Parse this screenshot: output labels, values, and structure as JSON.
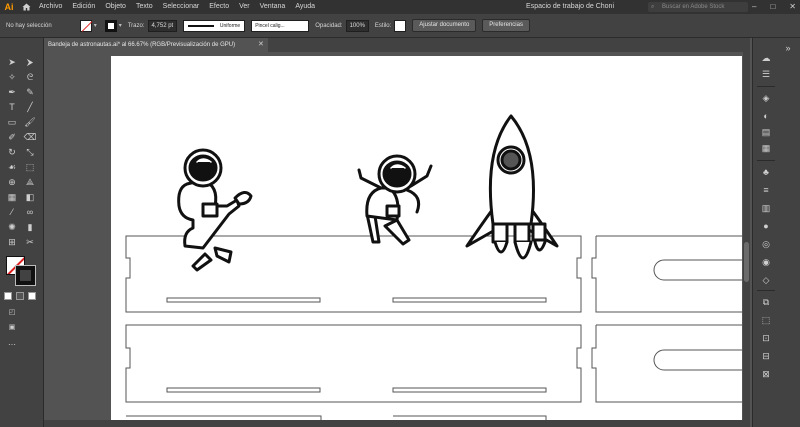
{
  "app": {
    "logo": "Ai",
    "home_icon": "home-icon"
  },
  "menu": [
    "Archivo",
    "Edición",
    "Objeto",
    "Texto",
    "Seleccionar",
    "Efecto",
    "Ver",
    "Ventana",
    "Ayuda"
  ],
  "workspace_label": "Espacio de trabajo de Choni",
  "search": {
    "placeholder": "Buscar en Adobe Stock"
  },
  "window_controls": {
    "minimize": "–",
    "maximize": "□",
    "close": "✕"
  },
  "control_bar": {
    "selection_status": "No hay selección",
    "stroke_label": "Trazo:",
    "stroke_weight": "4,752 pt",
    "stroke_profile": "Uniforme",
    "brush": "Pincel calig...",
    "opacity_label": "Opacidad:",
    "opacity_value": "100%",
    "style_label": "Estilo:",
    "doc_setup_button": "Ajustar documento",
    "preferences_button": "Preferencias"
  },
  "document_tab": {
    "title": "Bandeja de astronautas.ai* al 66.67% (RGB/Previsualización de GPU)",
    "close": "✕"
  },
  "colors": {
    "menubar": "#323232",
    "panel": "#424242",
    "canvas": "#535353",
    "artboard": "#ffffff",
    "accent": "#ff9a00",
    "none_slash": "#e02020"
  },
  "tools": [
    "selection-icon",
    "direct-selection-icon",
    "magic-wand-icon",
    "lasso-icon",
    "pen-icon",
    "curvature-icon",
    "type-icon",
    "line-icon",
    "rectangle-icon",
    "paintbrush-icon",
    "shaper-icon",
    "eraser-icon",
    "rotate-icon",
    "scale-icon",
    "warp-icon",
    "free-transform-icon",
    "shape-builder-icon",
    "perspective-icon",
    "mesh-icon",
    "gradient-icon",
    "eyedropper-icon",
    "blend-icon",
    "symbol-sprayer-icon",
    "column-graph-icon",
    "artboard-icon",
    "slice-icon",
    "hand-icon",
    "zoom-icon"
  ],
  "dock_icons": [
    "libraries-icon",
    "properties-icon",
    "layers-icon",
    "color-icon",
    "color-guide-icon",
    "swatches-icon",
    "brushes-icon",
    "symbols-icon",
    "stroke-icon",
    "gradient-panel-icon",
    "transparency-icon",
    "appearance-icon",
    "graphic-styles-icon",
    "asset-export-icon",
    "artboards-panel-icon",
    "transform-icon",
    "align-icon",
    "pathfinder-icon"
  ]
}
